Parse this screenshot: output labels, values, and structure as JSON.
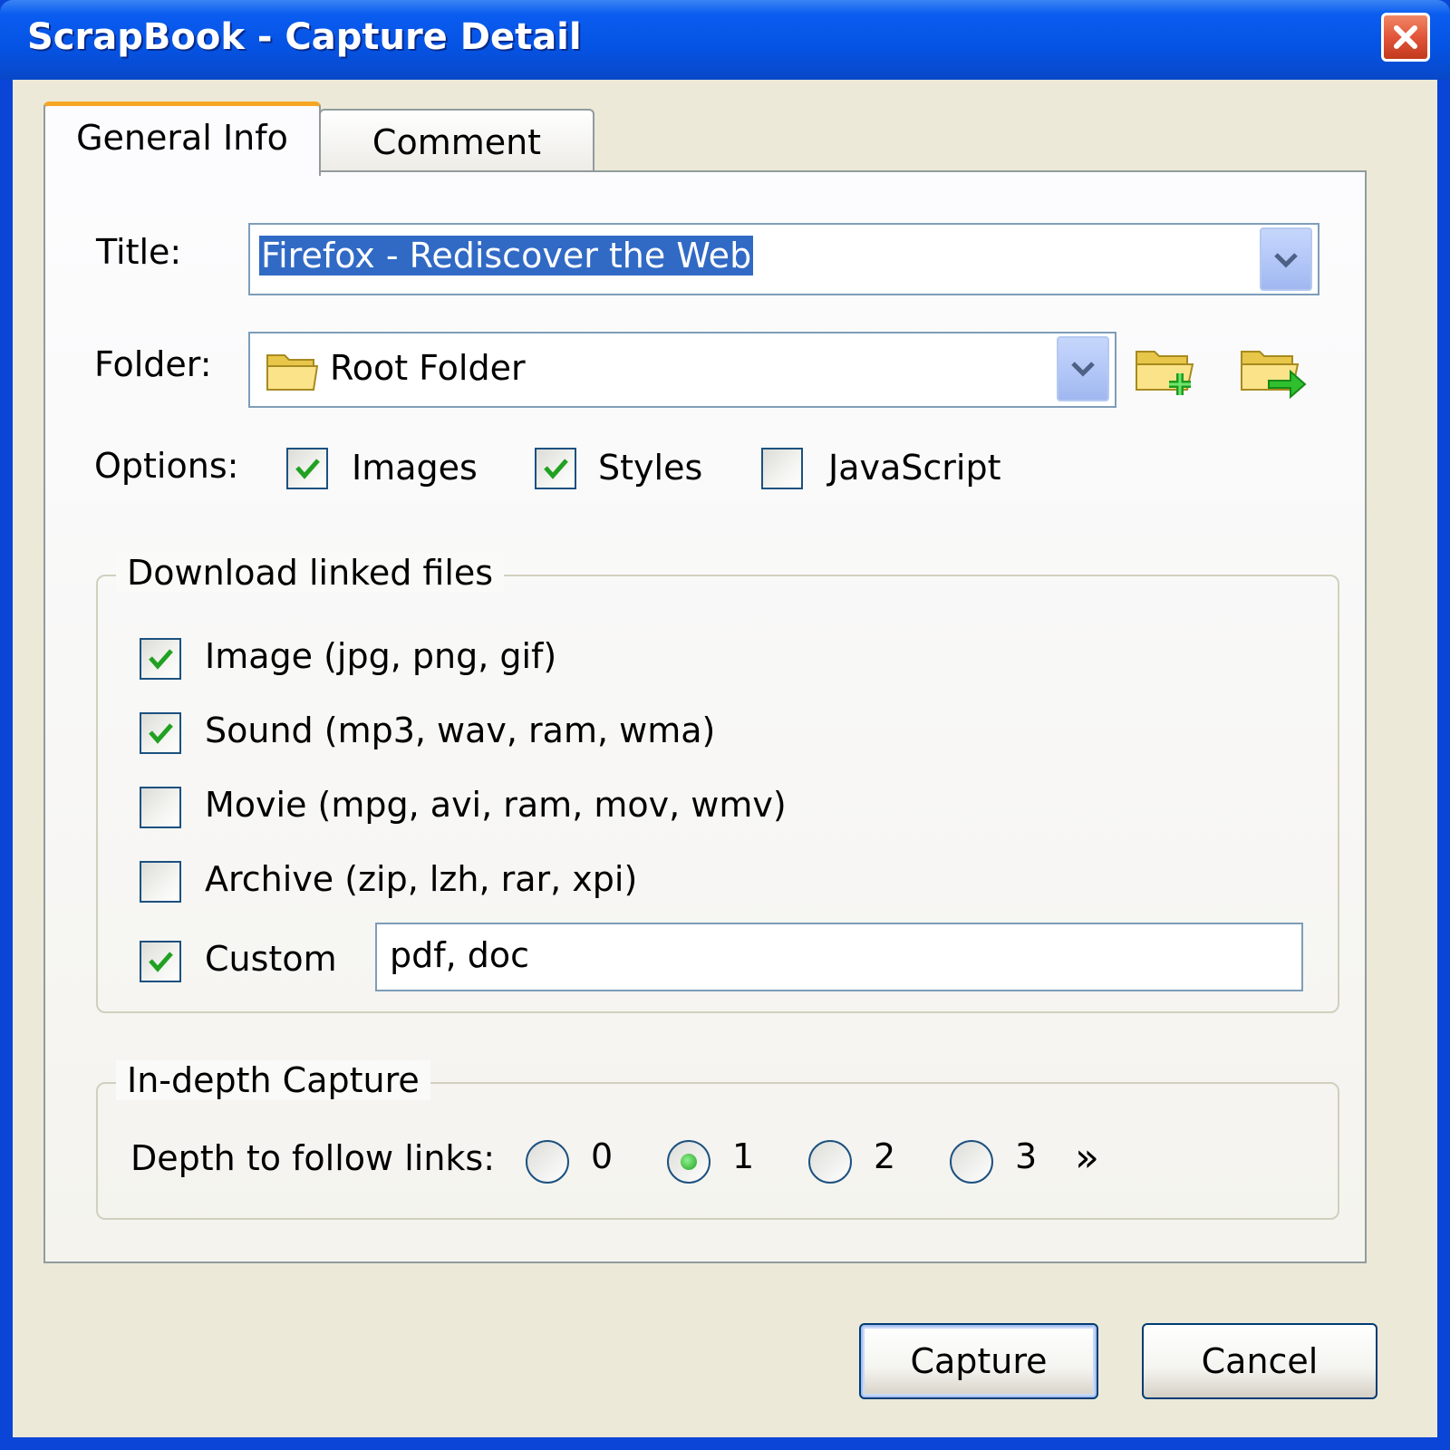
{
  "window": {
    "title": "ScrapBook - Capture Detail"
  },
  "tabs": [
    {
      "label": "General Info",
      "active": true
    },
    {
      "label": "Comment",
      "active": false
    }
  ],
  "general": {
    "title_label": "Title:",
    "title_value": "Firefox - Rediscover the Web",
    "folder_label": "Folder:",
    "folder_value": "Root Folder",
    "options_label": "Options:",
    "options": [
      {
        "label": "Images",
        "checked": true
      },
      {
        "label": "Styles",
        "checked": true
      },
      {
        "label": "JavaScript",
        "checked": false
      }
    ]
  },
  "download": {
    "legend": "Download linked files",
    "items": [
      {
        "label": "Image (jpg, png, gif)",
        "checked": true
      },
      {
        "label": "Sound (mp3, wav, ram, wma)",
        "checked": true
      },
      {
        "label": "Movie (mpg, avi, ram, mov, wmv)",
        "checked": false
      },
      {
        "label": "Archive (zip, lzh, rar, xpi)",
        "checked": false
      },
      {
        "label": "Custom",
        "checked": true
      }
    ],
    "custom_value": "pdf, doc"
  },
  "indepth": {
    "legend": "In-depth Capture",
    "depth_label": "Depth to follow links:",
    "levels": [
      "0",
      "1",
      "2",
      "3"
    ],
    "selected": "1",
    "more": "»"
  },
  "buttons": {
    "capture": "Capture",
    "cancel": "Cancel"
  },
  "icons": {
    "folder": "folder-icon",
    "new_folder": "folder-add-icon",
    "move_folder": "folder-go-icon",
    "close": "close-icon"
  },
  "colors": {
    "titlebar": "#0553e3",
    "selection": "#316ac5",
    "active_tab_accent": "#f5a623",
    "check": "#21a121"
  }
}
